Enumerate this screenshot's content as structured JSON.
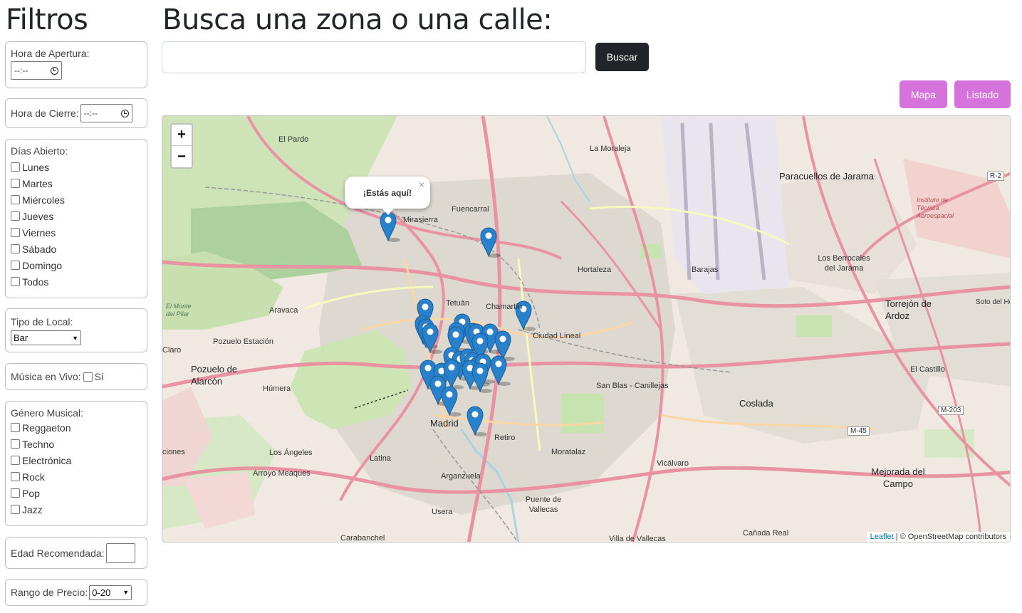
{
  "filters": {
    "title": "Filtros",
    "opening_label": "Hora de Apertura:",
    "closing_label": "Hora de Cierre:",
    "time_placeholder": "--:--",
    "days_label": "Días Abierto:",
    "days": [
      "Lunes",
      "Martes",
      "Miércoles",
      "Jueves",
      "Viernes",
      "Sábado",
      "Domingo",
      "Todos"
    ],
    "venue_type_label": "Tipo de Local:",
    "venue_type_value": "Bar",
    "live_music_label": "Música en Vivo:",
    "live_music_option": "Sí",
    "genre_label": "Género Musical:",
    "genres": [
      "Reggaeton",
      "Techno",
      "Electrónica",
      "Rock",
      "Pop",
      "Jazz"
    ],
    "age_label": "Edad Recomendada:",
    "price_label": "Rango de Precio:",
    "price_value": "0-20"
  },
  "main": {
    "title": "Busca una zona o una calle:",
    "search_button": "Buscar",
    "map_button": "Mapa",
    "list_button": "Listado"
  },
  "map": {
    "zoom_in": "+",
    "zoom_out": "−",
    "popup_text": "¡Estás aquí!",
    "popup_close": "×",
    "attribution_leaflet": "Leaflet",
    "attribution_rest": " | © OpenStreetMap contributors",
    "places": [
      {
        "name": "El Pardo"
      },
      {
        "name": "La Moraleja"
      },
      {
        "name": "Paracuellos de Jarama"
      },
      {
        "name": "Mirasierra"
      },
      {
        "name": "Fuencarral"
      },
      {
        "name": "Hortaleza"
      },
      {
        "name": "Barajas"
      },
      {
        "name": "Aravaca"
      },
      {
        "name": "Tetuán"
      },
      {
        "name": "Chamartín"
      },
      {
        "name": "Ciudad Lineal"
      },
      {
        "name": "Torrejón de Ardoz"
      },
      {
        "name": "Pozuelo Estación"
      },
      {
        "name": "Pozuelo de Alarcón"
      },
      {
        "name": "Húmera"
      },
      {
        "name": "San Blas - Canillejas"
      },
      {
        "name": "Coslada"
      },
      {
        "name": "El Castillo"
      },
      {
        "name": "Madrid"
      },
      {
        "name": "Retiro"
      },
      {
        "name": "Los Ángeles"
      },
      {
        "name": "Latina"
      },
      {
        "name": "Moratalaz"
      },
      {
        "name": "Vicálvaro"
      },
      {
        "name": "Arroyo Meaques"
      },
      {
        "name": "Arganzuela"
      },
      {
        "name": "Mejorada del Campo"
      },
      {
        "name": "Usera"
      },
      {
        "name": "Puente de Vallecas"
      },
      {
        "name": "Carabanchel"
      },
      {
        "name": "Villa de Vallecas"
      },
      {
        "name": "Cañada Real"
      },
      {
        "name": "Los Berrocales del Jarama"
      },
      {
        "name": "Instituto de Técnica Aeroespacial"
      },
      {
        "name": "Soto del Hen"
      },
      {
        "name": "Claro"
      },
      {
        "name": "El Monte del Pilar"
      },
      {
        "name": "ciones"
      }
    ],
    "road_labels": [
      "M-203",
      "M-45",
      "R-2"
    ],
    "markers": 30
  }
}
